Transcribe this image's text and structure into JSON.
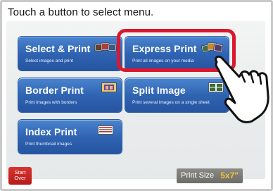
{
  "header": {
    "instruction": "Touch a button to select menu."
  },
  "menu": {
    "select_print": {
      "label": "Select & Print",
      "sub": "Select images and print",
      "icon": "photo-stack-icon"
    },
    "express_print": {
      "label": "Express Print",
      "sub": "Print all images on your media",
      "icon": "photo-stack-icon"
    },
    "border_print": {
      "label": "Border Print",
      "sub": "Print images with borders",
      "icon": "bordered-photo-icon"
    },
    "split_image": {
      "label": "Split Image",
      "sub": "Print several images on a single sheet",
      "icon": "split-photo-icon"
    },
    "index_print": {
      "label": "Index Print",
      "sub": "Print thumbnail images",
      "icon": "thumbnail-sheet-icon"
    }
  },
  "footer": {
    "start_over_line1": "Start",
    "start_over_line2": "Over",
    "print_size_label": "Print Size",
    "print_size_value": "5x7\""
  },
  "colors": {
    "button_blue": "#2f63b1",
    "highlight_red": "#d9172e",
    "start_red": "#c42624",
    "size_value_yellow": "#f0c437"
  }
}
